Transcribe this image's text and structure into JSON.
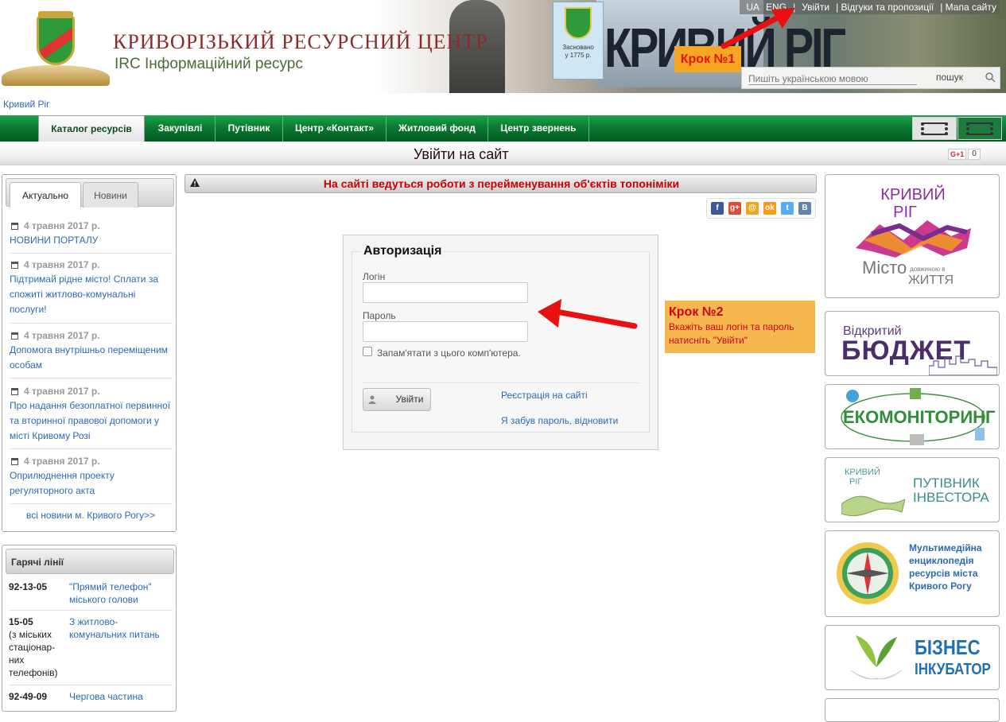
{
  "header": {
    "site_title": "КРИВОРІЗЬКИЙ РЕСУРСНИЙ ЦЕНТР",
    "site_subtitle": "IRC Інформаційний ресурс",
    "photo_coat_text": "Засновано\nу 1775 р.",
    "photo_sign_text": "КРИВИЙ РІГ",
    "toplinks": [
      "UA",
      "ENG",
      "|",
      "Увійти",
      "| Відгуки та пропозиції",
      "| Мапа сайту"
    ],
    "search_placeholder": "Пишіть українською мовою",
    "search_button": "пошук",
    "step1_label": "Крок №1"
  },
  "city_link": "Кривий Ріг",
  "nav": {
    "items": [
      {
        "label": "Каталог ресурсів",
        "active": true
      },
      {
        "label": "Закупівлі",
        "active": false
      },
      {
        "label": "Путівник",
        "active": false
      },
      {
        "label": "Центр «Контакт»",
        "active": false
      },
      {
        "label": "Житловий фонд",
        "active": false
      },
      {
        "label": "Центр звернень",
        "active": false
      }
    ]
  },
  "page": {
    "title": "Увійти на сайт",
    "gplus_label": "G+1",
    "gplus_count": "0"
  },
  "news": {
    "tabs": [
      "Актуально",
      "Новини"
    ],
    "items": [
      {
        "date": "4 травня 2017 р.",
        "text": "НОВИНИ ПОРТАЛУ"
      },
      {
        "date": "4 травня 2017 р.",
        "text": "Підтримай рідне місто! Сплати за спожиті житлово-комунальні послуги!"
      },
      {
        "date": "4 травня 2017 р.",
        "text": "Допомога внутрішньо переміщеним особам"
      },
      {
        "date": "4 травня 2017 р.",
        "text": "Про надання безоплатної первинної та вторинної правової допомоги у місті Кривому Розі"
      },
      {
        "date": "4 травня 2017 р.",
        "text": "Оприлюднення проекту регуляторного акта"
      }
    ],
    "all_link": "всі новини м. Кривого Рогу>>"
  },
  "hotlines": {
    "title": "Гарячі лінії",
    "rows": [
      {
        "number": "92-13-05",
        "note": "",
        "desc": "\"Прямий телефон\" міського голови"
      },
      {
        "number": "15-05",
        "note": "(з міських стаціонар-них телефонів)",
        "desc": "З житлово-комунальних питань"
      },
      {
        "number": "92-49-09",
        "note": "",
        "desc": "Чергова частина"
      }
    ]
  },
  "notice": "На сайті ведуться роботи з перейменування об'єктів топоніміки",
  "share_icons": [
    {
      "name": "facebook",
      "glyph": "f",
      "color": "#3b5998"
    },
    {
      "name": "google-plus",
      "glyph": "g+",
      "color": "#dd4b39"
    },
    {
      "name": "mail",
      "glyph": "@",
      "color": "#e9a91e"
    },
    {
      "name": "odnoklassniki",
      "glyph": "ok",
      "color": "#f59a1d"
    },
    {
      "name": "twitter",
      "glyph": "t",
      "color": "#55acee"
    },
    {
      "name": "vkontakte",
      "glyph": "B",
      "color": "#6383a8"
    }
  ],
  "auth": {
    "legend": "Авторизація",
    "login_label": "Логін",
    "login_value": "",
    "password_label": "Пароль",
    "password_value": "",
    "remember_label": "Запам'ятати з цього комп'ютера.",
    "submit_label": "Увійти",
    "register_link": "Реєстрація на сайті",
    "forgot_link": "Я забув пароль, відновити"
  },
  "step2": {
    "title": "Крок №2",
    "text": "Вкажіть ваш логін та пароль натисніть \"Увійти\""
  },
  "banners": {
    "city": {
      "line1": "КРИВИЙ",
      "line2": "РІГ",
      "line3": "Місто",
      "line4": "довжиною в",
      "line5": "ЖИТТЯ"
    },
    "budget": {
      "line1": "Відкритий",
      "line2": "БЮДЖЕТ"
    },
    "eco": {
      "label": "ЕКОМОНІТОРИНГ"
    },
    "investor": {
      "city1": "КРИВИЙ",
      "city2": "РІГ",
      "line1": "ПУТІВНИК",
      "line2": "ІНВЕСТОРА"
    },
    "encyclopedia": {
      "text": "Мультимедійна енциклопедія ресурсів міста Кривого Рогу"
    },
    "business": {
      "line1": "БІЗНЕС",
      "line2": "ІНКУБАТОР"
    }
  },
  "colors": {
    "nav_green": "#0d7a33",
    "link_blue": "#2a6ab3",
    "step_orange": "#f5a623",
    "step_red": "#e81010",
    "notice_red": "#cc0000"
  }
}
